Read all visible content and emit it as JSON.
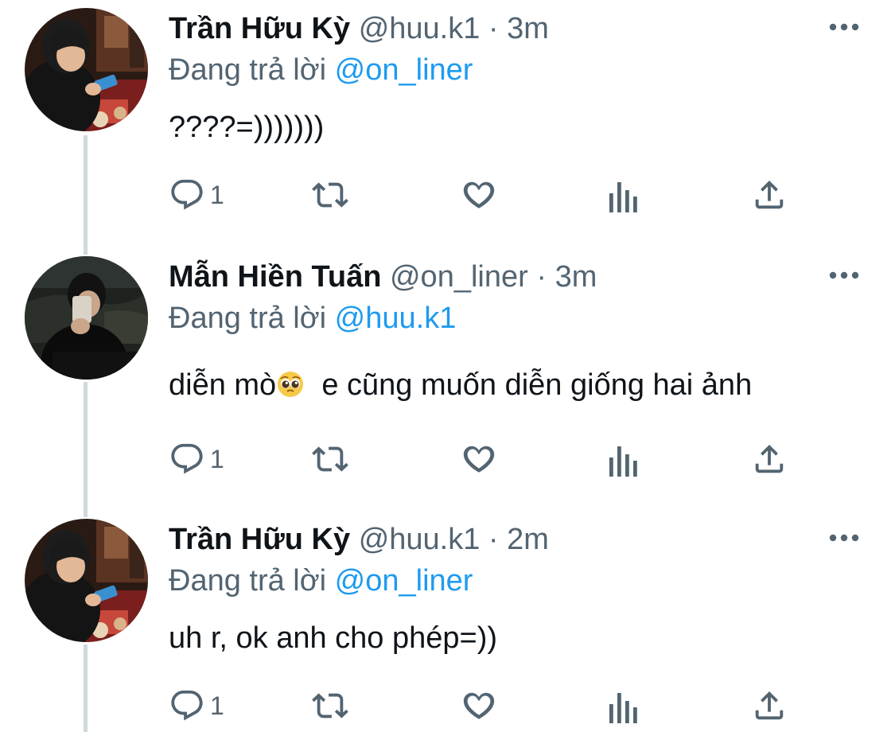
{
  "colors": {
    "text_primary": "#0f1419",
    "text_secondary": "#536471",
    "link": "#1d9bf0",
    "thread_line": "#cfd9de",
    "icon": "#536471"
  },
  "tweets": [
    {
      "author_name": "Trần Hữu Kỳ",
      "author_handle": "@huu.k1",
      "separator": "·",
      "time": "3m",
      "replying_prefix": "Đang trả lời",
      "replying_to": "@on_liner",
      "text": "????=)))))))",
      "reply_count": "1",
      "avatar": "person-at-table-avatar",
      "more_icon": "more-horizontal-icon"
    },
    {
      "author_name": "Mẫn Hiền Tuấn",
      "author_handle": "@on_liner",
      "separator": "·",
      "time": "3m",
      "replying_prefix": "Đang trả lời",
      "replying_to": "@huu.k1",
      "text_before_emoji": "diễn mò",
      "emoji": "pleading-face-emoji",
      "text_after_emoji": "e cũng muốn diễn giống hai ảnh",
      "reply_count": "1",
      "avatar": "person-with-phone-night-avatar",
      "more_icon": "more-horizontal-icon"
    },
    {
      "author_name": "Trần Hữu Kỳ",
      "author_handle": "@huu.k1",
      "separator": "·",
      "time": "2m",
      "replying_prefix": "Đang trả lời",
      "replying_to": "@on_liner",
      "text": "uh r, ok anh cho phép=))",
      "reply_count": "1",
      "avatar": "person-at-table-avatar",
      "more_icon": "more-horizontal-icon"
    }
  ],
  "action_icons": [
    "reply-icon",
    "retweet-icon",
    "like-icon",
    "analytics-icon",
    "share-icon"
  ]
}
